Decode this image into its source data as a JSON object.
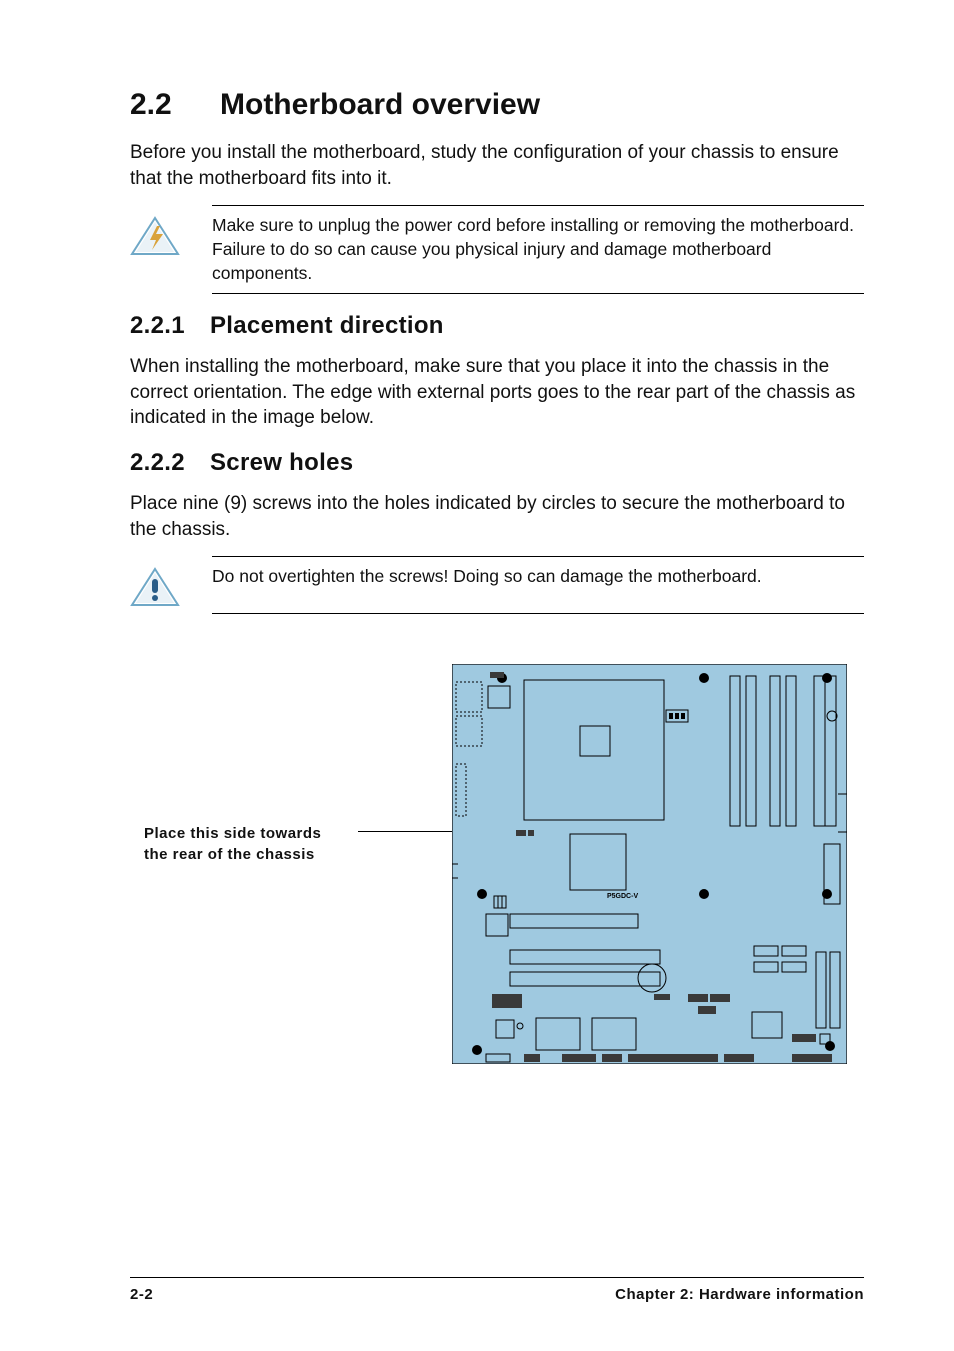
{
  "section": {
    "num": "2.2",
    "title": "Motherboard overview"
  },
  "intro": "Before you install the motherboard, study the configuration of your chassis to ensure that the motherboard fits into it.",
  "callout1": "Make sure to unplug the power cord before installing or removing the motherboard. Failure to do so can cause you physical injury and damage motherboard components.",
  "sub1": {
    "num": "2.2.1",
    "title": "Placement direction"
  },
  "sub1_body": "When installing the motherboard, make sure that you place it into the chassis in the correct orientation. The edge with external ports goes to the rear part of the chassis as indicated in the image below.",
  "sub2": {
    "num": "2.2.2",
    "title": "Screw holes"
  },
  "sub2_body": "Place nine (9) screws into the holes indicated by circles to secure the motherboard to the chassis.",
  "callout2": "Do not overtighten the screws! Doing so can damage the motherboard.",
  "diagram": {
    "caption_line1": "Place this side towards",
    "caption_line2": "the rear of the chassis",
    "board_label": "P5GDC-V"
  },
  "footer": {
    "page_num": "2-2",
    "chapter": "Chapter 2: Hardware information"
  }
}
